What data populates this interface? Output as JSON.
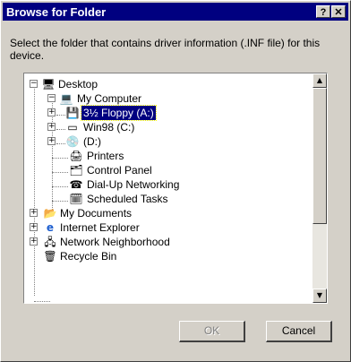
{
  "window": {
    "title": "Browse for Folder",
    "help_label": "?",
    "close_label": "✕"
  },
  "prompt": "Select the folder that contains driver information (.INF file) for this device.",
  "tree": {
    "items": [
      {
        "label": "Desktop",
        "icon": "desktop-icon",
        "expander": "−"
      },
      {
        "label": "My Computer",
        "icon": "computer-icon",
        "expander": "−"
      },
      {
        "label": "3½ Floppy (A:)",
        "icon": "floppy-icon",
        "expander": "+",
        "selected": true
      },
      {
        "label": "Win98 (C:)",
        "icon": "hard-drive-icon",
        "expander": "+"
      },
      {
        "label": "(D:)",
        "icon": "cd-drive-icon",
        "expander": "+"
      },
      {
        "label": "Printers",
        "icon": "printers-folder-icon",
        "expander": ""
      },
      {
        "label": "Control Panel",
        "icon": "control-panel-icon",
        "expander": ""
      },
      {
        "label": "Dial-Up Networking",
        "icon": "dialup-icon",
        "expander": ""
      },
      {
        "label": "Scheduled Tasks",
        "icon": "scheduled-tasks-icon",
        "expander": ""
      },
      {
        "label": "My Documents",
        "icon": "folder-icon",
        "expander": "+"
      },
      {
        "label": "Internet Explorer",
        "icon": "internet-explorer-icon",
        "expander": "+"
      },
      {
        "label": "Network Neighborhood",
        "icon": "network-icon",
        "expander": "+"
      },
      {
        "label": "Recycle Bin",
        "icon": "recycle-bin-icon",
        "expander": ""
      }
    ]
  },
  "scrollbar": {
    "up": "▲",
    "down": "▼"
  },
  "buttons": {
    "ok": "OK",
    "cancel": "Cancel"
  },
  "colors": {
    "selection": "#000080",
    "titlebar": "#000080",
    "face": "#d4d0c8"
  }
}
